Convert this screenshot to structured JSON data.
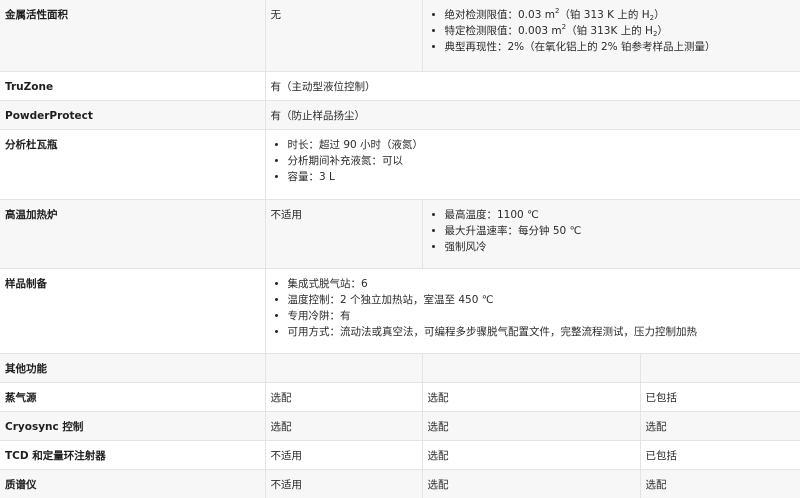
{
  "rows": [
    {
      "label": "金属活性面积",
      "c1": "无",
      "c2": {
        "a_pre": "绝对检测限值：0.03 m",
        "a_sup": "2",
        "a_mid": "（铂 313 K 上的 H",
        "a_sub": "2",
        "a_post": "）",
        "b_pre": "特定检测限值：0.003 m",
        "b_sup": "2",
        "b_mid": "（铂 313K 上的 H",
        "b_sub": "2",
        "b_post": "）",
        "c": "典型再现性：2%（在氧化铝上的 2% 铂参考样品上测量）"
      }
    },
    {
      "label": "TruZone",
      "value": "有（主动型液位控制）"
    },
    {
      "label": "PowderProtect",
      "value": "有（防止样品扬尘）"
    },
    {
      "label": "分析杜瓦瓶",
      "items": [
        "时长：超过 90 小时（液氮）",
        "分析期间补充液氮：可以",
        "容量：3 L"
      ]
    },
    {
      "label": "高温加热炉",
      "c1": "不适用",
      "items": [
        "最高温度：1100 ℃",
        "最大升温速率：每分钟 50 ℃",
        "强制风冷"
      ]
    },
    {
      "label": "样品制备",
      "items": [
        "集成式脱气站：6",
        "温度控制：2 个独立加热站，室温至 450 ℃",
        "专用冷阱：有",
        "可用方式：流动法或真空法，可编程多步骤脱气配置文件，完整流程测试，压力控制加热"
      ]
    },
    {
      "label": "其他功能"
    },
    {
      "label": "蒸气源",
      "cells": [
        "选配",
        "选配",
        "已包括"
      ]
    },
    {
      "label": "Cryosync 控制",
      "cells": [
        "选配",
        "选配",
        "选配"
      ]
    },
    {
      "label": "TCD 和定量环注射器",
      "cells": [
        "不适用",
        "选配",
        "已包括"
      ]
    },
    {
      "label": "质谱仪",
      "cells": [
        "不适用",
        "选配",
        "选配"
      ]
    }
  ]
}
